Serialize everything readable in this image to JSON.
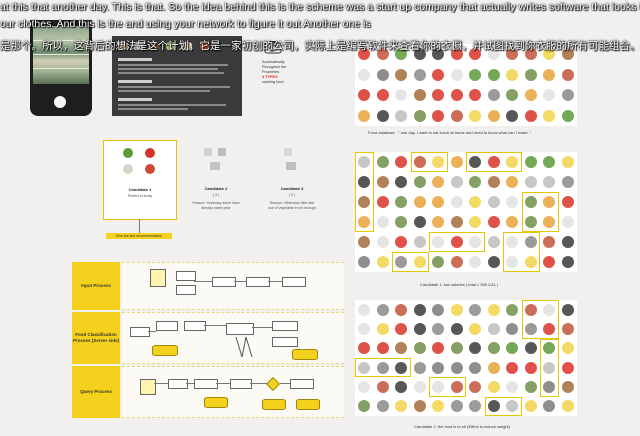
{
  "subtitles": {
    "line1": "at this that another day. This is that. So the idea behind this is the scheme was a start up company that actually writes software that looks into your wardrobe and",
    "line2": "our clothes. And this is the and using your network to figure it out Another one is",
    "line3": "是那个。所以，这背后的想法是这个计划，它是一家初创的公司，实际上是编写软件来查看你的衣橱，并试图找到你衣服的所有可能组合。这就是利用你的网络去"
  },
  "panel": {
    "auto_note_1": "Automatically",
    "auto_note_2": "Recognize the",
    "auto_note_3": "Properties",
    "auto_note_red": "4 TYPES",
    "auto_note_4": "cooking food"
  },
  "candidates": [
    {
      "title": "Candidate 1",
      "sub": "Perfect  in today"
    },
    {
      "title": "Candidate 2",
      "sub": "( 3 )",
      "reason": "Reason: Yesterday lunch have already eaten pear"
    },
    {
      "title": "Candidate 3",
      "sub": "( 3 )",
      "reason": "Reason: Otherwise after last use of vegetable in not enough"
    }
  ],
  "recommend_label": "Give the last recommendation",
  "flow": {
    "lane1": "Input Process",
    "lane2": "Food Classification Process (Server side)",
    "lane3": "Query Process"
  },
  "grid_captions": {
    "food_db_label": "Food database",
    "food_db_quote": "\" one day, I want to eat lunch at home and need to know what can I make. \"",
    "cand1": "Candidate 1: low calories ( total < 500 CAL )",
    "cand2": "Candidate 2: the food is to sh  (Effect to induce weight)"
  },
  "colors": {
    "accent": "#f4d11c",
    "dark_panel": "#3b3a3c",
    "red_text": "#dd2222"
  }
}
